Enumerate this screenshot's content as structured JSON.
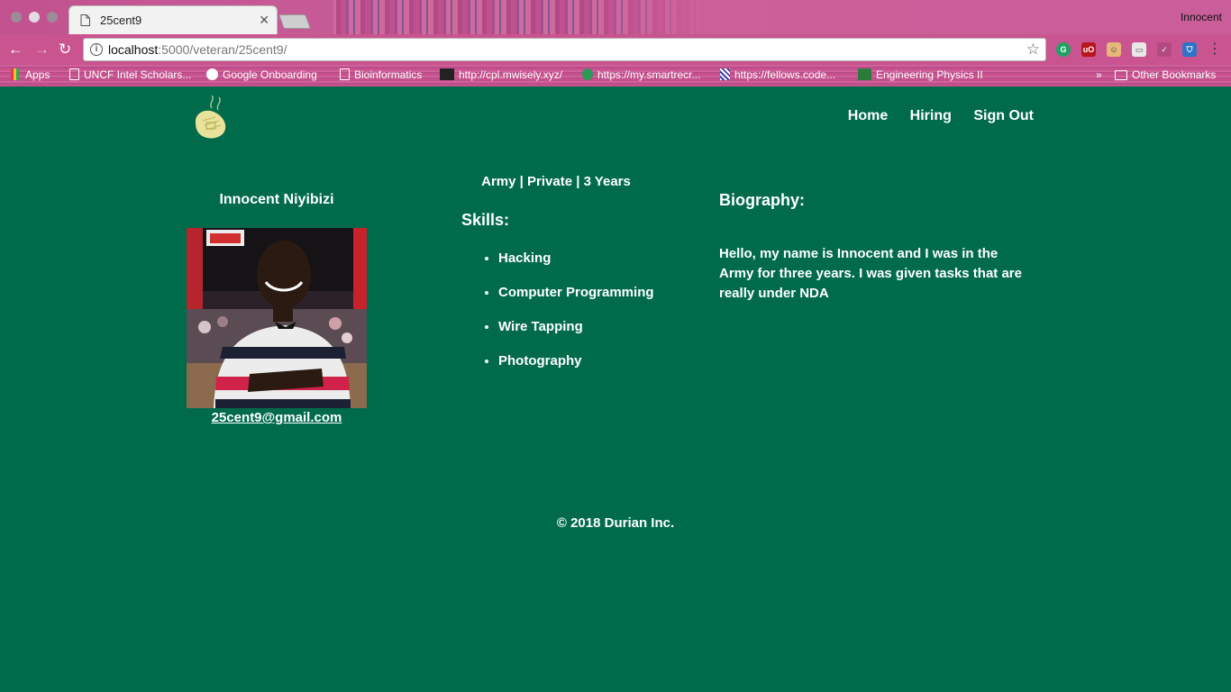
{
  "browser": {
    "tab_title": "25cent9",
    "profile_name": "Innocent",
    "url_host": "localhost",
    "url_rest": ":5000/veteran/25cent9/",
    "bookmarks": [
      {
        "label": "Apps",
        "icon": "apps-icon"
      },
      {
        "label": "UNCF Intel Scholars...",
        "icon": "page-icon"
      },
      {
        "label": "Google Onboarding",
        "icon": "google-icon"
      },
      {
        "label": "Bioinformatics",
        "icon": "page-icon"
      },
      {
        "label": "http://cpl.mwisely.xyz/",
        "icon": "cpl-icon"
      },
      {
        "label": "https://my.smartrecr...",
        "icon": "smartrecruiters-icon"
      },
      {
        "label": "https://fellows.code...",
        "icon": "fellows-icon"
      },
      {
        "label": "Engineering Physics II",
        "icon": "physics-icon"
      }
    ],
    "overflow": "»",
    "other_bookmarks": "Other Bookmarks"
  },
  "nav": {
    "home": "Home",
    "hiring": "Hiring",
    "sign_out": "Sign Out"
  },
  "profile": {
    "name": "Innocent Niyibizi",
    "email": "25cent9@gmail.com",
    "meta": "Army | Private | 3 Years"
  },
  "skills": {
    "title": "Skills:",
    "items": [
      "Hacking",
      "Computer Programming",
      "Wire Tapping",
      "Photography"
    ]
  },
  "bio": {
    "title": "Biography:",
    "text": "Hello, my name is Innocent and I was in the Army for three years. I was given tasks that are really under NDA"
  },
  "footer": {
    "text": "© 2018 Durian Inc."
  },
  "colors": {
    "page_bg": "#006b4b",
    "chrome_pink": "#c9548f",
    "logo_fill": "#e8e29a"
  }
}
